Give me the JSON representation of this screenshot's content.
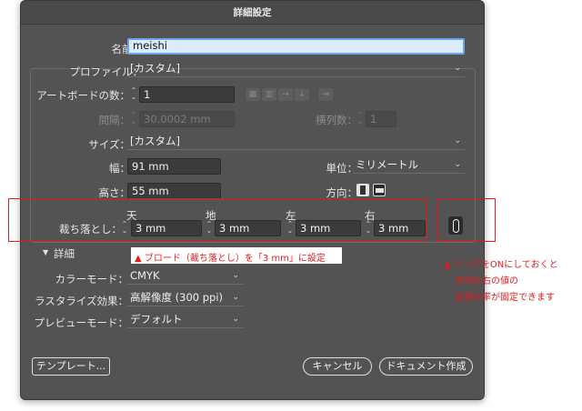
{
  "window": {
    "title": "詳細設定"
  },
  "name": {
    "label": "名前：",
    "value": "meishi"
  },
  "profile": {
    "label": "プロファイル：",
    "value": "[カスタム]"
  },
  "artboards": {
    "label": "アートボードの数：",
    "value": "1"
  },
  "spacing": {
    "label": "間隔：",
    "value": "30.0002 mm"
  },
  "columns": {
    "label": "横列数：",
    "value": "1"
  },
  "size": {
    "label": "サイズ：",
    "value": "[カスタム]"
  },
  "width": {
    "label": "幅：",
    "value": "91 mm"
  },
  "units": {
    "label": "単位：",
    "value": "ミリメートル"
  },
  "height": {
    "label": "高さ：",
    "value": "55 mm"
  },
  "orientation": {
    "label": "方向："
  },
  "bleed": {
    "label": "裁ち落とし：",
    "top": {
      "label": "天",
      "value": "3 mm"
    },
    "bottom": {
      "label": "地",
      "value": "3 mm"
    },
    "left": {
      "label": "左",
      "value": "3 mm"
    },
    "right": {
      "label": "右",
      "value": "3 mm"
    }
  },
  "advanced": {
    "label": "詳細"
  },
  "color_mode": {
    "label": "カラーモード：",
    "value": "CMYK"
  },
  "raster": {
    "label": "ラスタライズ効果：",
    "value": "高解像度 (300 ppi)"
  },
  "preview": {
    "label": "プレビューモード：",
    "value": "デフォルト"
  },
  "buttons": {
    "templates": "テンプレート...",
    "cancel": "キャンセル",
    "create": "ドキュメント作成"
  },
  "annotations": {
    "bleed_note": "▲ ブロード（裁ち落とし）を「3 mm」に設定",
    "link_note_1": "▲ リンクをONにしておくと",
    "link_note_2": "天地左右の値の",
    "link_note_3": "変更比率が固定できます"
  },
  "colors": {
    "dialog_bg": "#535353",
    "annotation_red": "#e11c1c",
    "name_highlight": "#dcecff"
  }
}
